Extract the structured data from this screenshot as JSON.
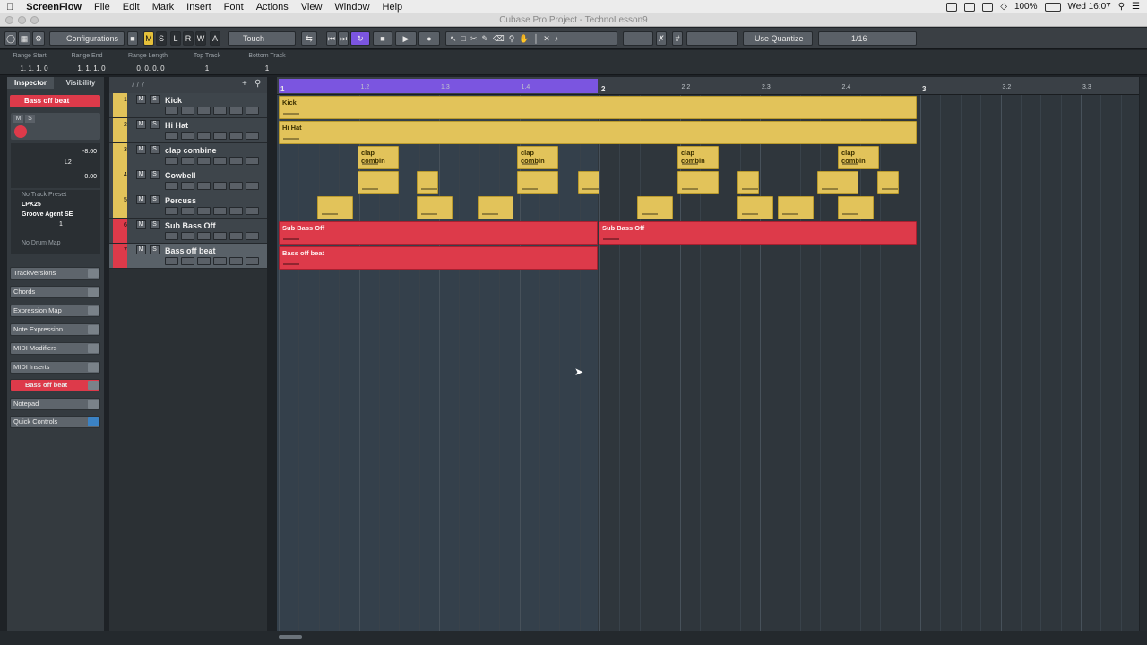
{
  "menubar": {
    "app": "ScreenFlow",
    "items": [
      "File",
      "Edit",
      "Mark",
      "Insert",
      "Font",
      "Actions",
      "View",
      "Window",
      "Help"
    ],
    "battery": "100%",
    "clock": "Wed 16:07"
  },
  "window": {
    "title": "Cubase Pro Project - TechnoLesson9"
  },
  "toolbar": {
    "configurations": "Configurations",
    "msr": [
      "M",
      "S",
      "L",
      "R",
      "W",
      "A"
    ],
    "automation_mode": "Touch",
    "quantize_label": "Use Quantize",
    "quantize_value": "1/16"
  },
  "infoline": {
    "headers": [
      "Range Start",
      "Range End",
      "Range Length",
      "Top Track",
      "Bottom Track"
    ],
    "values": [
      "1. 1. 1.   0",
      "1. 1. 1.   0",
      "0. 0. 0.   0",
      "1",
      "1"
    ]
  },
  "inspector": {
    "tabs": [
      "Inspector",
      "Visibility"
    ],
    "track_name": "Bass off beat",
    "volume": "-8.60",
    "pan": "L2",
    "pan_value": "0.00",
    "track_preset": "No Track Preset",
    "input": "LPK25",
    "instrument": "Groove Agent SE",
    "channel": "1",
    "drum_map": "No Drum Map",
    "sections": [
      "TrackVersions",
      "Chords",
      "Expression Map",
      "Note Expression",
      "MIDI Modifiers",
      "MIDI Inserts",
      "Bass off beat",
      "Notepad",
      "Quick Controls"
    ]
  },
  "tracklist": {
    "counter": "7 / 7",
    "tracks": [
      {
        "num": "1",
        "name": "Kick"
      },
      {
        "num": "2",
        "name": "Hi Hat"
      },
      {
        "num": "3",
        "name": "clap combine"
      },
      {
        "num": "4",
        "name": "Cowbell"
      },
      {
        "num": "5",
        "name": "Percuss"
      },
      {
        "num": "6",
        "name": "Sub Bass Off"
      },
      {
        "num": "7",
        "name": "Bass off beat"
      }
    ]
  },
  "ruler": {
    "labels": [
      "1",
      "1.2",
      "1.3",
      "1.4",
      "2",
      "2.2",
      "2.3",
      "2.4",
      "3",
      "3.2",
      "3.3"
    ]
  },
  "events": {
    "kick": "Kick",
    "hihat": "Hi Hat",
    "clap": "clap combin",
    "subbass": "Sub Bass Off",
    "bassoff": "Bass off beat"
  },
  "colors": {
    "midi_yellow": "#e2c35a",
    "bass_red": "#dd3a4a",
    "loop_purple": "#7b55e0"
  }
}
